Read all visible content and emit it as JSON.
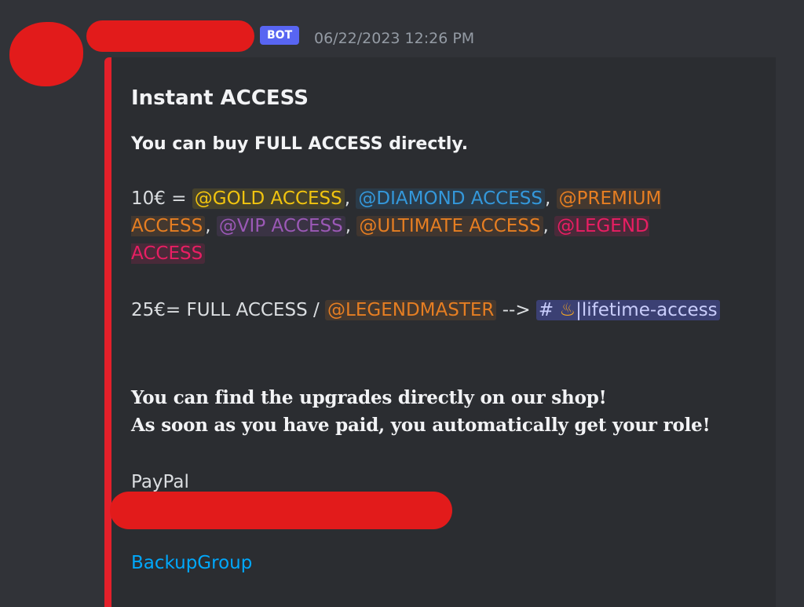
{
  "message": {
    "bot_tag": "BOT",
    "timestamp": "06/22/2023 12:26 PM"
  },
  "embed": {
    "title": "Instant ACCESS",
    "intro": "You can buy FULL ACCESS directly",
    "intro_period": ".",
    "price_line_1": {
      "prefix": "10€ = ",
      "roles": [
        {
          "label": "@GOLD ACCESS",
          "color": "#f1c40f"
        },
        {
          "label": "@DIAMOND ACCESS",
          "color": "#3498db"
        },
        {
          "label": "@PREMIUM ACCESS",
          "color": "#e67e22"
        },
        {
          "label": "@VIP ACCESS",
          "color": "#9b59b6"
        },
        {
          "label": "@ULTIMATE ACCESS",
          "color": "#e67e22"
        },
        {
          "label": "@LEGEND ACCESS",
          "color": "#e91e63"
        }
      ],
      "separator": ", "
    },
    "price_line_2": {
      "prefix": "25€= FULL ACCESS / ",
      "role": "@LEGENDMASTER",
      "arrow": " --> ",
      "channel_hash": "#",
      "channel_icon": "flame-icon",
      "channel_name": "|lifetime-access"
    },
    "info_line_1": "You can find the upgrades directly on our shop",
    "info_line_1_end": "!",
    "info_line_2": "As soon as you have paid, you automatically get your role",
    "info_line_2_end": "!",
    "paypal_label": "PayPal",
    "backup_link": "BackupGroup",
    "accent_color": "#e3202a"
  }
}
